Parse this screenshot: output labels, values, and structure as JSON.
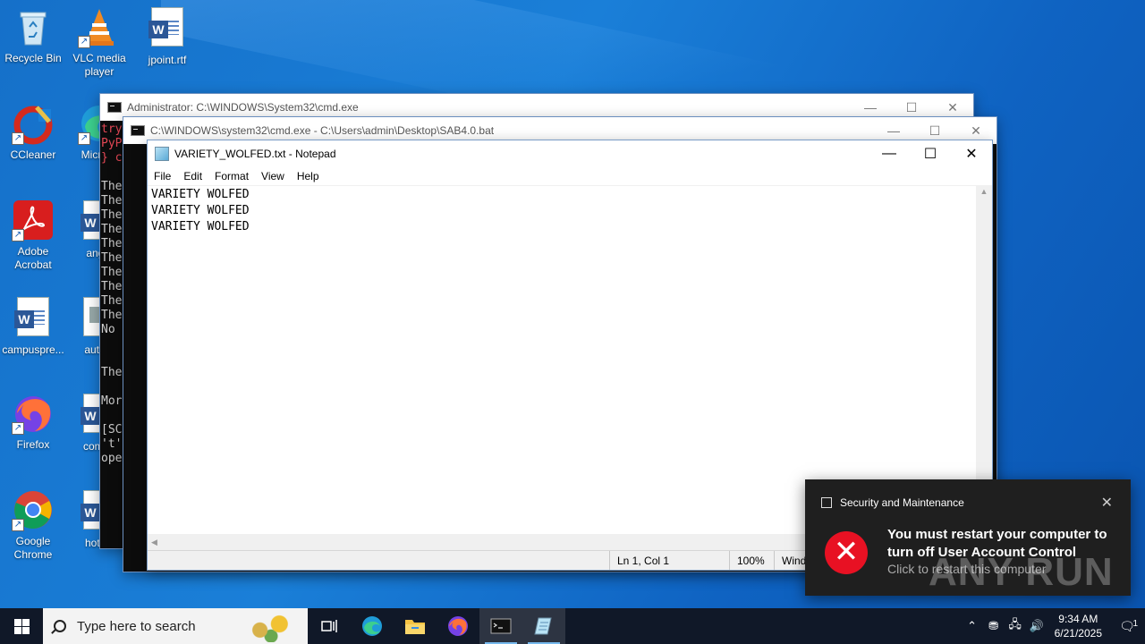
{
  "desktop": {
    "icons": [
      {
        "label": "Recycle Bin",
        "icon": "recycle-bin-icon"
      },
      {
        "label": "VLC media player",
        "icon": "vlc-icon"
      },
      {
        "label": "jpoint.rtf",
        "icon": "word-document-icon"
      },
      {
        "label": "CCleaner",
        "icon": "ccleaner-icon"
      },
      {
        "label": "Microsoft Edge",
        "visible_label": "Micr Ed",
        "icon": "edge-icon"
      },
      {
        "label": "Adobe Acrobat",
        "icon": "adobe-acrobat-icon"
      },
      {
        "label": "angel",
        "icon": "word-document-icon"
      },
      {
        "label": "campuspre...",
        "icon": "word-document-icon"
      },
      {
        "label": "autom",
        "icon": "image-file-icon"
      },
      {
        "label": "Firefox",
        "icon": "firefox-icon"
      },
      {
        "label": "compa",
        "icon": "word-document-icon"
      },
      {
        "label": "Google Chrome",
        "icon": "chrome-icon"
      },
      {
        "label": "hotels",
        "icon": "word-document-icon"
      }
    ]
  },
  "windows": {
    "admin_cmd": {
      "title": "Administrator: C:\\WINDOWS\\System32\\cmd.exe",
      "lines": [
        {
          "text": "try",
          "color": "#e74856"
        },
        {
          "text": "PyP",
          "color": "#e74856"
        },
        {
          "text": "} c",
          "color": "#e74856"
        },
        {
          "text": "",
          "color": "#cccccc"
        },
        {
          "text": "The",
          "color": "#cccccc"
        },
        {
          "text": "The",
          "color": "#cccccc"
        },
        {
          "text": "The",
          "color": "#cccccc"
        },
        {
          "text": "The",
          "color": "#cccccc"
        },
        {
          "text": "The",
          "color": "#cccccc"
        },
        {
          "text": "The",
          "color": "#cccccc"
        },
        {
          "text": "The",
          "color": "#cccccc"
        },
        {
          "text": "The",
          "color": "#cccccc"
        },
        {
          "text": "The",
          "color": "#cccccc"
        },
        {
          "text": "The",
          "color": "#cccccc"
        },
        {
          "text": "No",
          "color": "#cccccc"
        },
        {
          "text": "",
          "color": "#cccccc"
        },
        {
          "text": "",
          "color": "#cccccc"
        },
        {
          "text": "The",
          "color": "#cccccc"
        },
        {
          "text": "",
          "color": "#cccccc"
        },
        {
          "text": "Mor",
          "color": "#cccccc"
        },
        {
          "text": "",
          "color": "#cccccc"
        },
        {
          "text": "[SC",
          "color": "#cccccc"
        },
        {
          "text": "'t'",
          "color": "#cccccc"
        },
        {
          "text": "ope",
          "color": "#cccccc"
        }
      ]
    },
    "bat_cmd": {
      "title": "C:\\WINDOWS\\system32\\cmd.exe - C:\\Users\\admin\\Desktop\\SAB4.0.bat"
    },
    "notepad": {
      "title": "VARIETY_WOLFED.txt - Notepad",
      "menu": [
        "File",
        "Edit",
        "Format",
        "View",
        "Help"
      ],
      "content": "VARIETY WOLFED\nVARIETY WOLFED\nVARIETY WOLFED",
      "status": {
        "position": "Ln 1, Col 1",
        "zoom": "100%",
        "line_ending": "Wind"
      }
    }
  },
  "toast": {
    "source": "Security and Maintenance",
    "message": "You must restart your computer to turn off User Account Control",
    "sub": "Click to restart this computer",
    "accent": "#e81123"
  },
  "watermark": "ANY RUN",
  "taskbar": {
    "search_placeholder": "Type here to search",
    "apps": [
      "task-view-icon",
      "edge-icon",
      "file-explorer-icon",
      "firefox-icon",
      "cmd-icon",
      "notepad-icon"
    ],
    "time": "9:34 AM",
    "date": "6/21/2025",
    "notifications": "1"
  }
}
